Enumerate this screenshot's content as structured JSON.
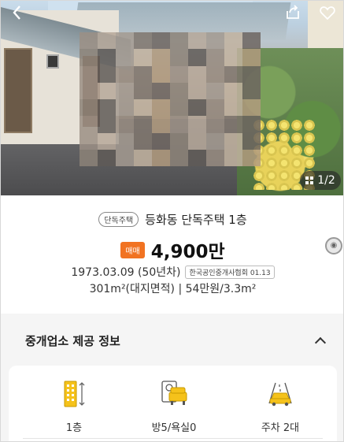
{
  "photo": {
    "counter": "1/2"
  },
  "listing": {
    "type_badge": "단독주택",
    "title": "등화동 단독주택 1층",
    "deal_type": "매매",
    "price": "4,900만",
    "built_date": "1973.03.09 (50년차)",
    "association_note": "한국공인중개사협회 01.13",
    "area_text": "301m²(대지면적) | 54만원/3.3m²"
  },
  "broker_section": {
    "title": "중개업소 제공 정보",
    "features": [
      {
        "icon": "building-floor-icon",
        "label": "1층"
      },
      {
        "icon": "room-bath-icon",
        "label": "방5/욕실0"
      },
      {
        "icon": "parking-icon",
        "label": "주차 2대"
      }
    ]
  },
  "colors": {
    "accent": "#f17322",
    "feature_icon": "#f5c21b"
  }
}
